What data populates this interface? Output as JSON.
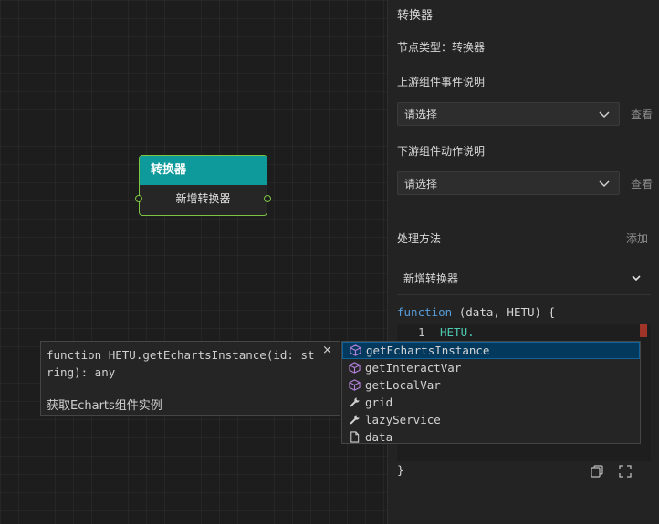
{
  "node": {
    "title": "转换器",
    "body": "新增转换器"
  },
  "panel": {
    "title": "转换器",
    "node_type": "节点类型：转换器",
    "upstream_label": "上游组件事件说明",
    "upstream_select": "请选择",
    "upstream_view": "查看",
    "downstream_label": "下游组件动作说明",
    "downstream_select": "请选择",
    "downstream_view": "查看",
    "method_label": "处理方法",
    "method_add": "添加",
    "method_select": "新增转换器"
  },
  "code": {
    "signature_kw": "function",
    "signature_rest": " (data, HETU) {",
    "line_no": "1",
    "line_text": "HETU.",
    "closing": "}"
  },
  "tooltip": {
    "signature": "function HETU.getEchartsInstance(id: string): any",
    "description": "获取Echarts组件实例",
    "close": "×"
  },
  "suggestions": [
    {
      "label": "getEchartsInstance",
      "icon": "method-cube-icon"
    },
    {
      "label": "getInteractVar",
      "icon": "method-cube-icon"
    },
    {
      "label": "getLocalVar",
      "icon": "method-cube-icon"
    },
    {
      "label": "grid",
      "icon": "wrench-icon"
    },
    {
      "label": "lazyService",
      "icon": "wrench-icon"
    },
    {
      "label": "data",
      "icon": "file-icon"
    }
  ],
  "colors": {
    "node_header": "#0e9a9a",
    "node_border": "#7ec341",
    "keyword": "#569cd6",
    "selection": "#04395e",
    "method_icon": "#b180d7"
  }
}
